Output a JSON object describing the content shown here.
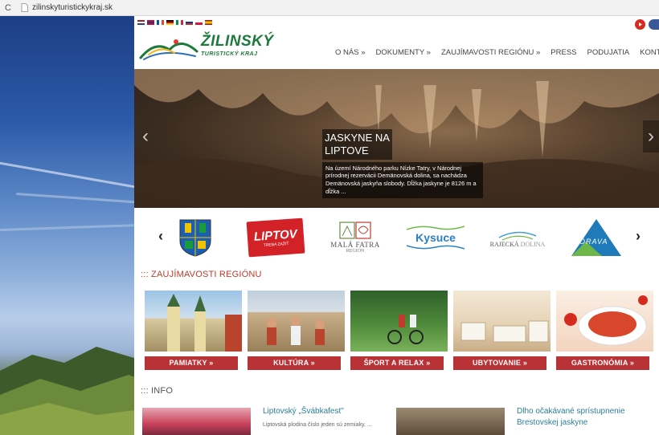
{
  "browser": {
    "reload_icon": "C",
    "url": "zilinskyturistickykraj.sk"
  },
  "flags": [
    "nl",
    "gb",
    "fr",
    "de",
    "it",
    "ru",
    "pl",
    "es"
  ],
  "logo": {
    "line1": "ŽILINSKÝ",
    "line2": "TURISTICKÝ KRAJ"
  },
  "nav": {
    "items": [
      "O NÁS »",
      "DOKUMENTY »",
      "ZAUJÍMAVOSTI REGIÓNU »",
      "PRESS",
      "PODUJATIA",
      "KONTAKTY"
    ]
  },
  "hero": {
    "title_line1": "JASKYNE NA",
    "title_line2": "LIPTOVE",
    "description": "Na území Národného parku Nízke Tatry, v Národnej prírodnej rezervácii Demänovská dolina, sa nachádza Demänovská jaskyňa slobody. Dĺžka jaskyne je 8126 m a dĺžka ..."
  },
  "partners": {
    "liptov": "LIPTOV",
    "liptov_sub": "TREBA ZAŽIŤ",
    "mala_fatra": "MALÁ FATRA",
    "mala_fatra_sub": "REGIÓN",
    "kysuce": "Kysuce",
    "rajecka": "RAJECKÁ",
    "rajecka2": "DOLINA",
    "orava": "ORAVA"
  },
  "sections": {
    "zaujimavosti": "::: ZAUJÍMAVOSTI REGIÓNU",
    "info": "::: INFO"
  },
  "tiles": [
    "PAMIATKY »",
    "KULTÚRA »",
    "ŠPORT A RELAX »",
    "UBYTOVANIE »",
    "GASTRONÓMIA »"
  ],
  "news": [
    {
      "title": "Liptovský „Švábkafest\"",
      "text": "Liptovská plodina číslo jeden sú zemiaky, ... "
    },
    {
      "title": "Dlho očakávané sprístupnenie Brestovskej jaskyne",
      "text": ""
    }
  ],
  "colors": {
    "accent_red": "#b83236",
    "brand_green": "#1c7a3a",
    "link_blue": "#2a7f9a"
  }
}
